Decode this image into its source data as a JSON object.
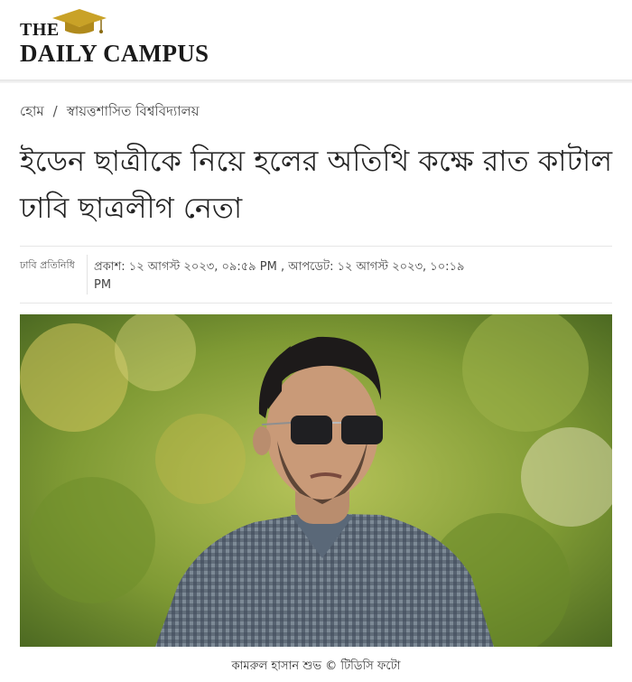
{
  "site": {
    "logo_the": "THE",
    "logo_name": "DAILY CAMPUS"
  },
  "breadcrumb": {
    "home": "হোম",
    "separator": "/",
    "category": "স্বায়ত্তশাসিত বিশ্ববিদ্যালয়"
  },
  "article": {
    "title": "ইডেন ছাত্রীকে নিয়ে হলের অতিথি কক্ষে রাত কাটাল ঢাবি ছাত্রলীগ নেতা",
    "author": "ঢাবি প্রতিনিধি",
    "dates": "প্রকাশ: ১২ আগস্ট ২০২৩, ০৯:৫৯ PM , আপডেট: ১২ আগস্ট ২০২৩, ১০:১৯ PM",
    "photo_caption": "কামরুল হাসান শুভ  © টিডিসি ফটো"
  },
  "icons": {
    "logo_emblem": "graduation-cap-icon"
  },
  "colors": {
    "logo_gold": "#c9a227",
    "text": "#222222"
  }
}
